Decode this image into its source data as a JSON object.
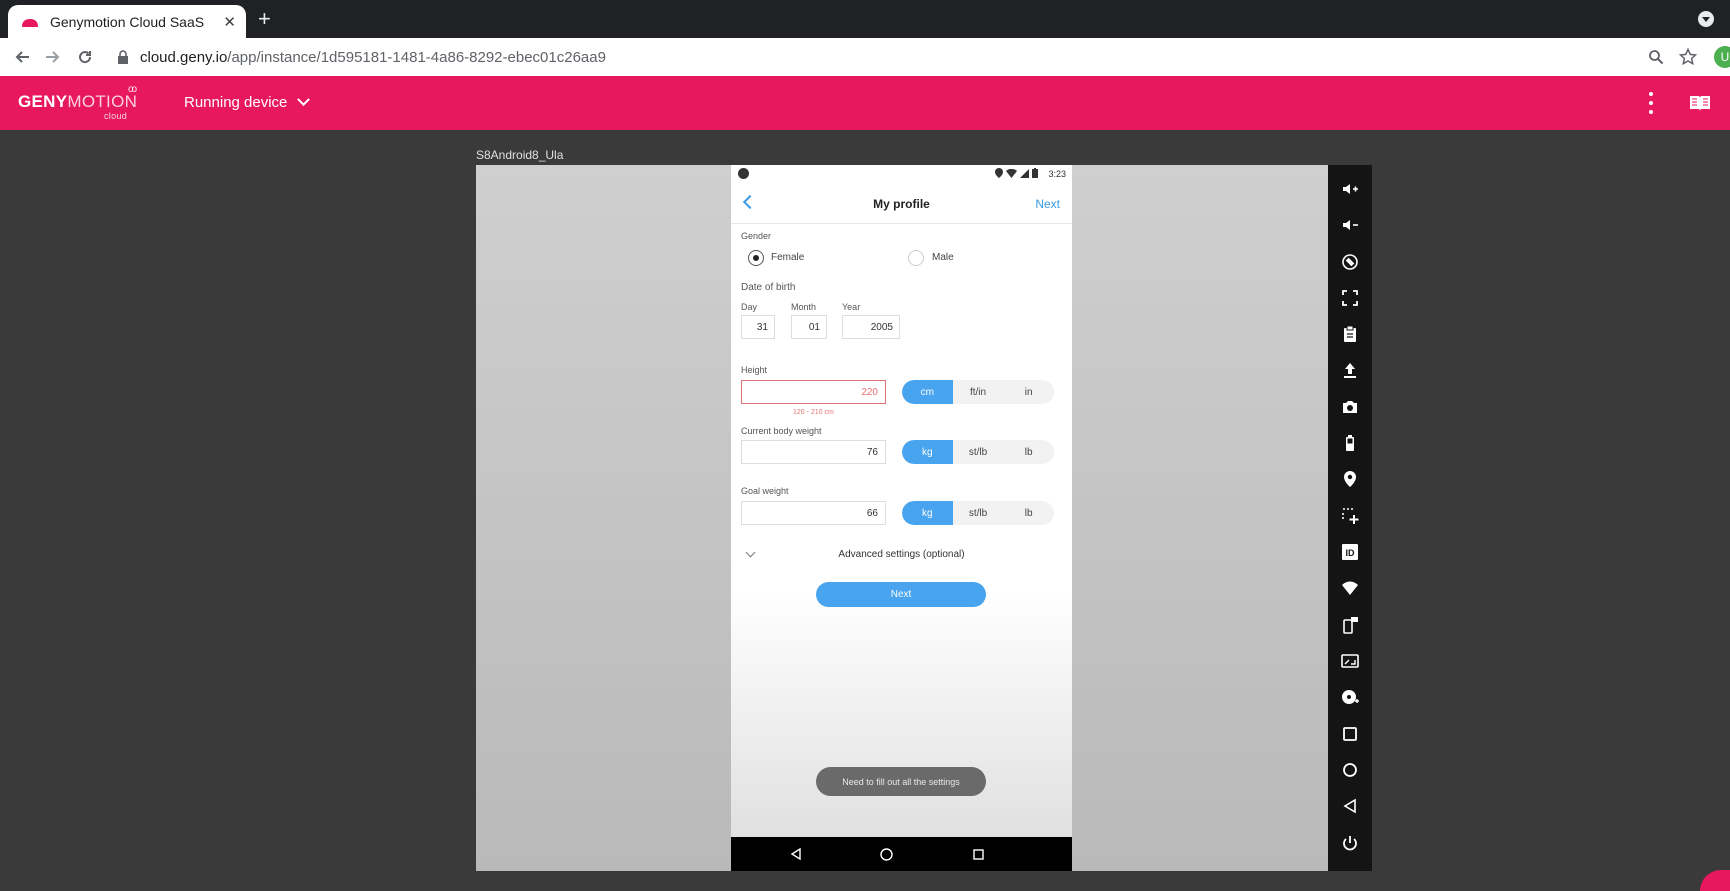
{
  "browser": {
    "tab_title": "Genymotion Cloud SaaS",
    "tab_close": "✕",
    "new_tab": "+",
    "url_host": "cloud.geny.io",
    "url_path": "/app/instance/1d595181-1481-4a86-8292-ebec01c26aa9",
    "profile_initial": "U"
  },
  "header": {
    "logo_bold": "GENY",
    "logo_light": "MOTION",
    "logo_sub": "cloud",
    "logo_rings": "oo",
    "menu_label": "Running device"
  },
  "device": {
    "name": "S8Android8_Ula"
  },
  "phone": {
    "status_time": "3:23",
    "title": "My profile",
    "next_link": "Next",
    "gender_label": "Gender",
    "gender_female": "Female",
    "gender_male": "Male",
    "gender_selected": "Female",
    "dob_label": "Date of birth",
    "day_label": "Day",
    "month_label": "Month",
    "year_label": "Year",
    "day_value": "31",
    "month_value": "01",
    "year_value": "2005",
    "height_label": "Height",
    "height_value": "220",
    "height_hint": "120 - 210 cm",
    "height_units": [
      "cm",
      "ft/in",
      "in"
    ],
    "weight_label": "Current body weight",
    "weight_value": "76",
    "weight_units": [
      "kg",
      "st/lb",
      "lb"
    ],
    "goal_label": "Goal weight",
    "goal_value": "66",
    "goal_units": [
      "kg",
      "st/lb",
      "lb"
    ],
    "advanced_label": "Advanced settings (optional)",
    "next_button": "Next",
    "toast": "Need to fill out all the settings"
  },
  "sidebar_icons": [
    "volume-up-icon",
    "volume-down-icon",
    "rotate-icon",
    "fullscreen-icon",
    "clipboard-icon",
    "upload-icon",
    "camera-icon",
    "battery-icon",
    "gps-icon",
    "multitouch-icon",
    "device-id-icon",
    "wifi-icon",
    "phone-icon",
    "resize-icon",
    "disk-icon",
    "recent-apps-icon",
    "home-icon",
    "back-icon",
    "power-icon"
  ],
  "colors": {
    "brand": "#e8185f",
    "accent": "#48a4ee",
    "error": "#e57373"
  }
}
